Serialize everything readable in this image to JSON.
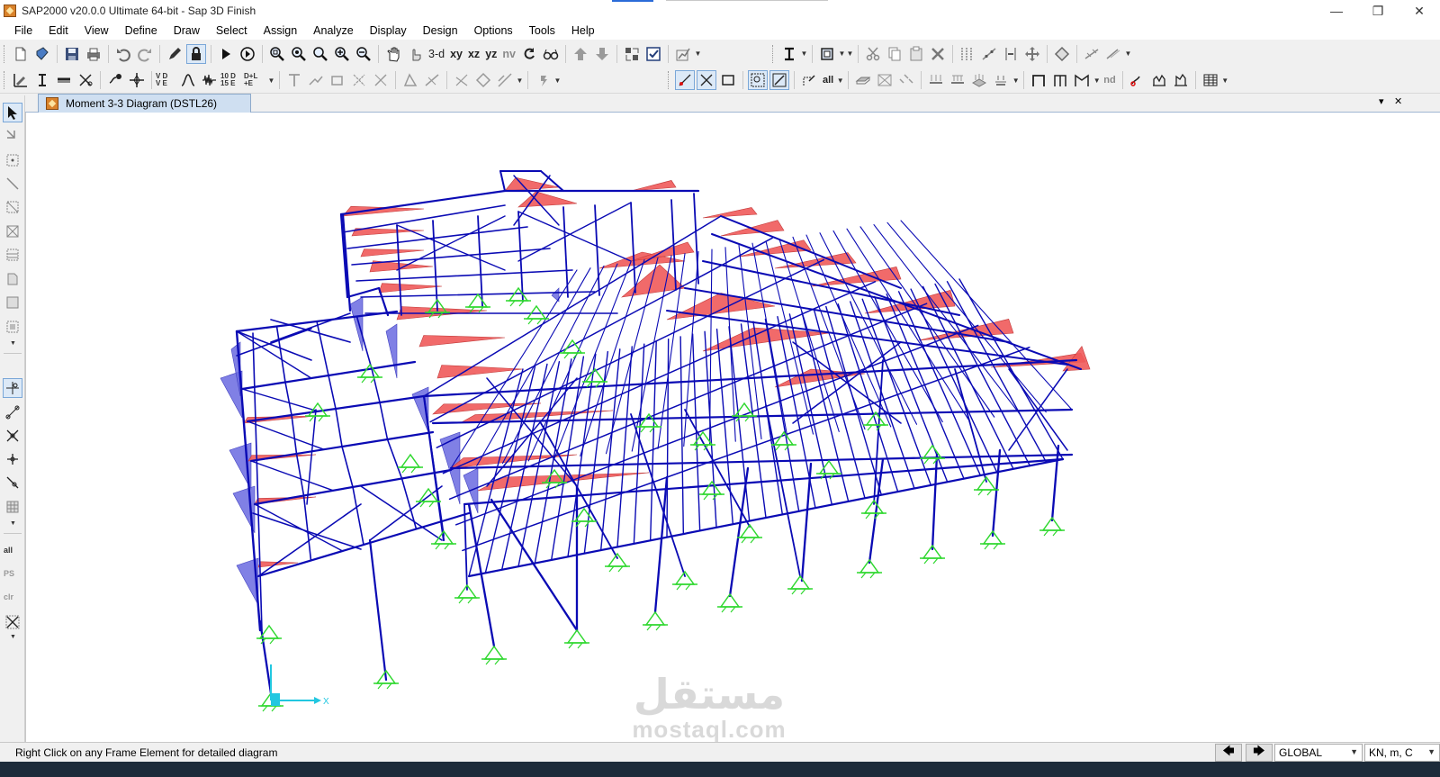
{
  "window": {
    "title": "SAP2000 v20.0.0 Ultimate 64-bit - Sap 3D Finish",
    "minimize": "—",
    "restore": "❐",
    "close": "✕"
  },
  "menu": [
    "File",
    "Edit",
    "View",
    "Define",
    "Draw",
    "Select",
    "Assign",
    "Analyze",
    "Display",
    "Design",
    "Options",
    "Tools",
    "Help"
  ],
  "toolbar": {
    "view_3d": "3-d",
    "view_xy": "xy",
    "view_xz": "xz",
    "view_yz": "yz",
    "view_nv": "nv",
    "nd": "nd",
    "all": "all",
    "d1_top": "10 D",
    "d1_bottom": "15 E",
    "d2_top": "D+L",
    "d2_bottom": "+E",
    "v_d": "V D",
    "v_e": "V E"
  },
  "left_toolbar": {
    "all_label": "all",
    "ps_label": "PS",
    "clr_label": "clr"
  },
  "document": {
    "tab_title": "Moment 3-3 Diagram (DSTL26)",
    "dropdown_glyph": "▾",
    "close_glyph": "✕"
  },
  "axis": {
    "x_label": "X"
  },
  "watermark": {
    "arabic": "مستقل",
    "latin": "mostaql.com"
  },
  "statusbar": {
    "message": "Right Click on any Frame Element for detailed diagram",
    "coord_system": "GLOBAL",
    "units": "KN, m, C",
    "prev": "🡄",
    "next": "🡆"
  },
  "colors": {
    "frame": "#0a0ab4",
    "moment_fill": "#f05a5a",
    "column_moment_fill": "#6a6ae0",
    "support": "#2fd82f",
    "tab_bg": "#cfdff1"
  }
}
